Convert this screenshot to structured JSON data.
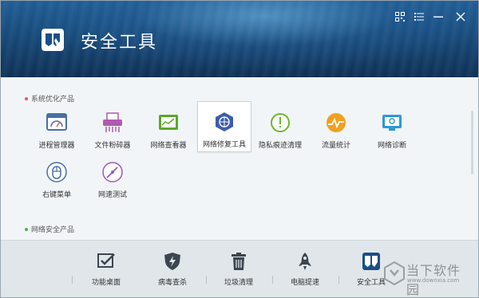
{
  "app": {
    "title": "安全工具"
  },
  "window_controls": [
    {
      "name": "qr-icon"
    },
    {
      "name": "menu-icon"
    },
    {
      "name": "minimize-icon"
    },
    {
      "name": "close-icon"
    }
  ],
  "sections": {
    "optimize": {
      "label": "系统优化产品",
      "dot_color": "#e05a5a"
    },
    "security": {
      "label": "网络安全产品",
      "dot_color": "#4fb04f"
    }
  },
  "tools": [
    {
      "label": "进程管理器",
      "icon": "process-manager-icon",
      "color": "#4a6fa5"
    },
    {
      "label": "文件粉碎器",
      "icon": "file-shredder-icon",
      "color": "#b05ab0"
    },
    {
      "label": "网络查看器",
      "icon": "network-viewer-icon",
      "color": "#5aa82a"
    },
    {
      "label": "网络修复工具",
      "icon": "network-repair-icon",
      "color": "#3a5db0",
      "selected": true
    },
    {
      "label": "隐私痕迹清理",
      "icon": "privacy-clean-icon",
      "color": "#6bb82a"
    },
    {
      "label": "流量统计",
      "icon": "traffic-stats-icon",
      "color": "#f0a020"
    },
    {
      "label": "网络诊断",
      "icon": "network-diagnosis-icon",
      "color": "#2a9ad8"
    },
    {
      "label": "右键菜单",
      "icon": "right-click-menu-icon",
      "color": "#4a6fa5"
    },
    {
      "label": "网速测试",
      "icon": "speed-test-icon",
      "color": "#9a5ab8"
    }
  ],
  "bottom_nav": [
    {
      "label": "功能桌面",
      "icon": "desktop-check-icon"
    },
    {
      "label": "病毒查杀",
      "icon": "shield-lightning-icon"
    },
    {
      "label": "垃圾清理",
      "icon": "trash-icon"
    },
    {
      "label": "电脑提速",
      "icon": "rocket-icon"
    },
    {
      "label": "安全工具",
      "icon": "security-tools-icon",
      "active": true
    }
  ],
  "watermark": {
    "title": "当下软件园",
    "url": "www.downxia.com"
  }
}
